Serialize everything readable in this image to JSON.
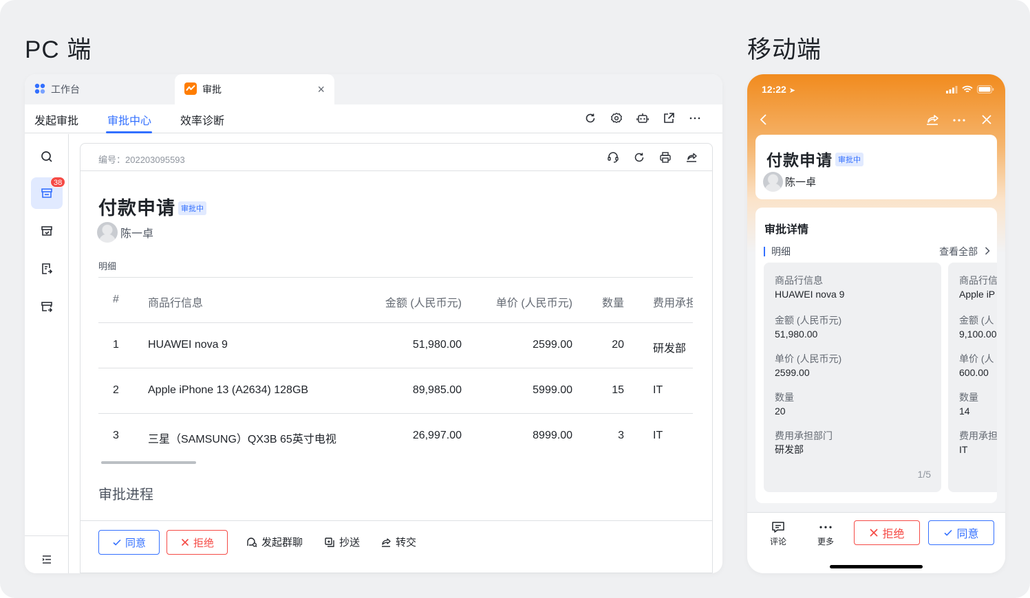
{
  "pc_section_title": "PC 端",
  "mobile_section_title": "移动端",
  "pc": {
    "tabs": [
      {
        "label": "工作台",
        "icon": "workbench-icon"
      },
      {
        "label": "审批",
        "icon": "approval-app-icon"
      }
    ],
    "nav": [
      "发起审批",
      "审批中心",
      "效率诊断"
    ],
    "nav_active": "审批中心",
    "toolbar_icons": [
      "refresh-icon",
      "settings-icon",
      "bot-icon",
      "open-external-icon",
      "more-icon"
    ],
    "sidebar": {
      "items": [
        "search-icon",
        "inbox-icon",
        "archive-icon",
        "submitted-icon",
        "cc-icon"
      ],
      "badge": "38",
      "bottom_icon": "collapse-menu-icon"
    },
    "card": {
      "serial": "编号：202203095593",
      "header_icons": [
        "headset-icon",
        "refresh-icon",
        "print-icon",
        "share-icon"
      ],
      "title": "付款申请",
      "status": "审批中",
      "applicant": "陈一卓",
      "detail_label": "明细",
      "table": {
        "headers": [
          "#",
          "商品行信息",
          "金额 (人民币元)",
          "单价 (人民币元)",
          "数量",
          "费用承担"
        ],
        "rows": [
          [
            "1",
            "HUAWEI nova 9",
            "51,980.00",
            "2599.00",
            "20",
            "研发部"
          ],
          [
            "2",
            "Apple iPhone 13 (A2634) 128GB",
            "89,985.00",
            "5999.00",
            "15",
            "IT"
          ],
          [
            "3",
            "三星（SAMSUNG）QX3B 65英寸电视",
            "26,997.00",
            "8999.00",
            "3",
            "IT"
          ]
        ]
      },
      "process_title": "审批进程",
      "footer": {
        "agree": "同意",
        "reject": "拒绝",
        "actions": [
          {
            "label": "发起群聊",
            "icon": "group-chat-icon"
          },
          {
            "label": "抄送",
            "icon": "copy-send-icon"
          },
          {
            "label": "转交",
            "icon": "transfer-icon"
          }
        ]
      }
    }
  },
  "mobile": {
    "time": "12:22",
    "title": "付款申请",
    "status": "审批中",
    "applicant": "陈一卓",
    "detail_title": "审批详情",
    "detail_sub": "明细",
    "view_all": "查看全部",
    "items": [
      {
        "fields": [
          {
            "k": "商品行信息",
            "v": "HUAWEI nova 9"
          },
          {
            "k": "金额 (人民币元)",
            "v": "51,980.00"
          },
          {
            "k": "单价 (人民币元)",
            "v": "2599.00"
          },
          {
            "k": "数量",
            "v": "20"
          },
          {
            "k": "费用承担部门",
            "v": "研发部"
          }
        ],
        "pager": "1/5"
      },
      {
        "fields": [
          {
            "k": "商品行信",
            "v": "Apple iP"
          },
          {
            "k": "金额 (人",
            "v": "9,100.00"
          },
          {
            "k": "单价 (人",
            "v": "600.00"
          },
          {
            "k": "数量",
            "v": "14"
          },
          {
            "k": "费用承担",
            "v": "IT"
          }
        ]
      }
    ],
    "footer": {
      "comment": "评论",
      "more": "更多",
      "reject": "拒绝",
      "agree": "同意"
    },
    "colors": {
      "header_gradient_top": "#f18b1e",
      "accent": "#3370ff",
      "danger": "#f54a45"
    }
  }
}
